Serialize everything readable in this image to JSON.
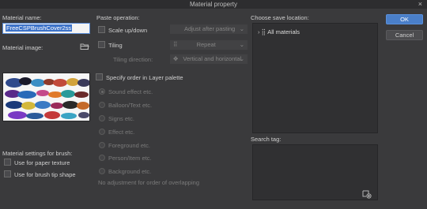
{
  "window": {
    "title": "Material property",
    "close_glyph": "×"
  },
  "left": {
    "material_name_label": "Material name:",
    "material_name_value": "FreeCSPBrushCover2ss",
    "material_image_label": "Material image:",
    "folder_icon": "folder-icon",
    "brush_settings_label": "Material settings for brush:",
    "use_paper_texture": "Use for paper texture",
    "use_brush_tip": "Use for brush tip shape"
  },
  "paste": {
    "label": "Paste operation:",
    "scale_label": "Scale up/down",
    "scale_option": "Adjust after pasting",
    "tiling_label": "Tiling",
    "tiling_option": "Repeat",
    "tiling_direction_label": "Tiling direction:",
    "tiling_direction_option": "Vertical and horizontal",
    "specify_order_label": "Specify order in Layer palette",
    "orders": [
      "Sound effect etc.",
      "Balloon/Text etc.",
      "Signs etc.",
      "Effect etc.",
      "Foreground etc.",
      "Person/Item etc.",
      "Background etc."
    ],
    "no_adjust_note": "No adjustment for order of overlapping"
  },
  "save": {
    "label": "Choose save location:",
    "tree_root": "All materials",
    "search_tag_label": "Search tag:"
  },
  "buttons": {
    "ok": "OK",
    "cancel": "Cancel"
  },
  "colors": {
    "background": "#3a3a3c",
    "accent": "#4a7fc9",
    "input_border": "#5a8cd6"
  }
}
